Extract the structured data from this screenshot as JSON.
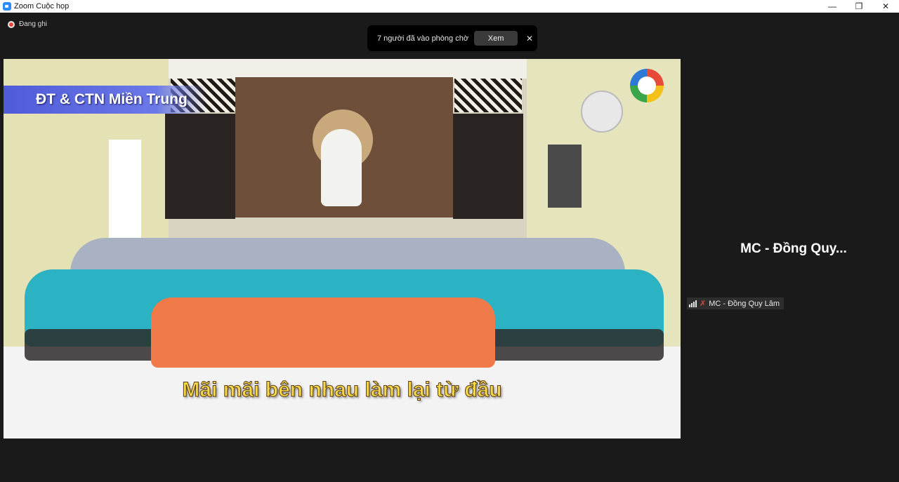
{
  "window": {
    "title": "Zoom Cuộc họp",
    "controls": {
      "minimize": "—",
      "restore": "❐",
      "close": "✕"
    }
  },
  "recording": {
    "label": "Đang ghi",
    "color": "#e0463b"
  },
  "waiting_room": {
    "message": "7 người đã vào phòng chờ",
    "view_button": "Xem",
    "close_symbol": "✕"
  },
  "video": {
    "banner": "ĐT & CTN Miền Trung",
    "caption": "Mãi mãi bên nhau làm lại từ đầu"
  },
  "participant": {
    "display_name": "MC - Đồng Quy...",
    "tag_name": "MC - Đồng Quy Lâm",
    "muted_icon": "mic-muted-icon",
    "signal_icon": "signal-strength-icon"
  },
  "colors": {
    "background": "#1a1a1a",
    "accent": "#2d8cff",
    "caption_yellow": "#f4d84a",
    "banner_blue": "#4f5bd8"
  }
}
